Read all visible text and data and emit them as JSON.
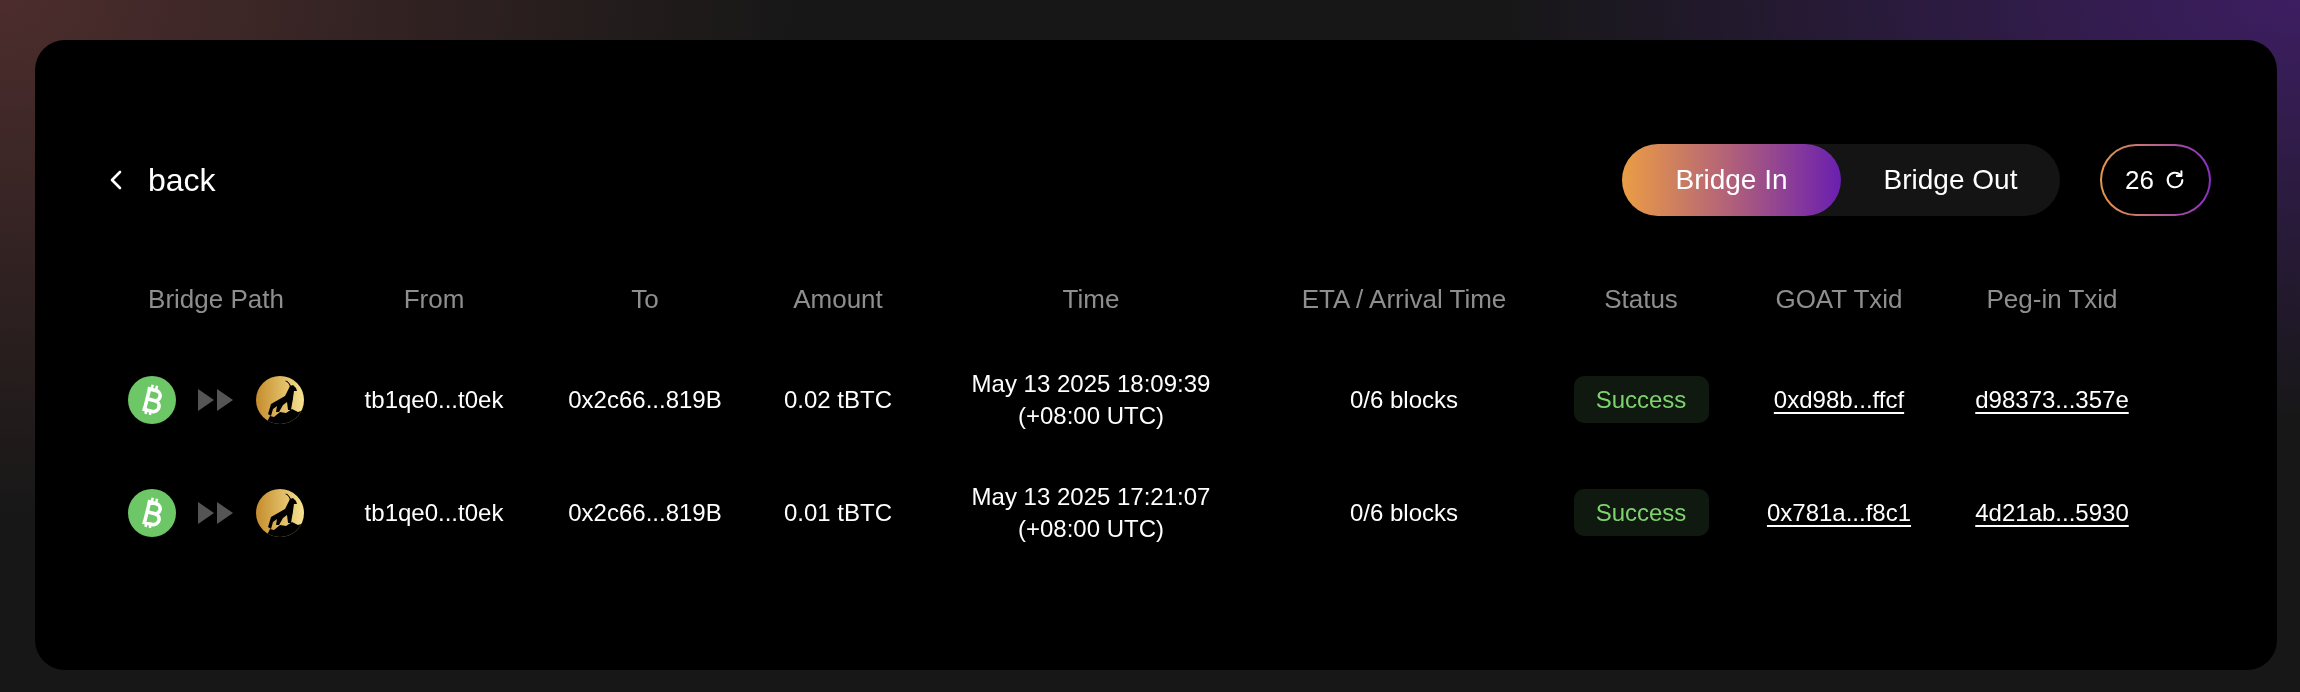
{
  "back": {
    "label": "back"
  },
  "mode_toggle": [
    {
      "label": "Bridge In",
      "selected": true
    },
    {
      "label": "Bridge Out",
      "selected": false
    }
  ],
  "refresh_button": {
    "label": "26"
  },
  "table": {
    "columns": [
      "Bridge Path",
      "From",
      "To",
      "Amount",
      "Time",
      "ETA / Arrival Time",
      "Status",
      "GOAT Txid",
      "Peg-in Txid"
    ],
    "rows": [
      {
        "from": "tb1qe0...t0ek",
        "to": "0x2c66...819B",
        "amount": "0.02 tBTC",
        "time": "May 13 2025 18:09:39 (+08:00 UTC)",
        "eta": "0/6 blocks",
        "status": "Success",
        "goat_txid": "0xd98b...ffcf",
        "pegin_txid": "d98373...357e"
      },
      {
        "from": "tb1qe0...t0ek",
        "to": "0x2c66...819B",
        "amount": "0.01 tBTC",
        "time": "May 13 2025 17:21:07 (+08:00 UTC)",
        "eta": "0/6 blocks",
        "status": "Success",
        "goat_txid": "0x781a...f8c1",
        "pegin_txid": "4d21ab...5930"
      }
    ]
  }
}
